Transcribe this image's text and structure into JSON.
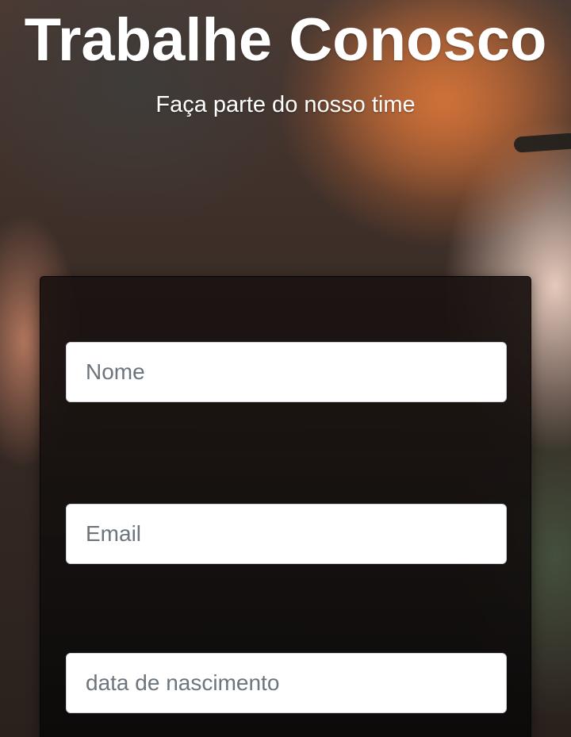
{
  "hero": {
    "title": "Trabalhe Conosco",
    "subtitle": "Faça parte do nosso time"
  },
  "form": {
    "name_placeholder": "Nome",
    "email_placeholder": "Email",
    "birthdate_placeholder": "data de nascimento"
  },
  "colors": {
    "hero_text": "#ffffff",
    "card_background": "#1a1411",
    "input_background": "#ffffff",
    "placeholder_text": "#6c757d"
  }
}
